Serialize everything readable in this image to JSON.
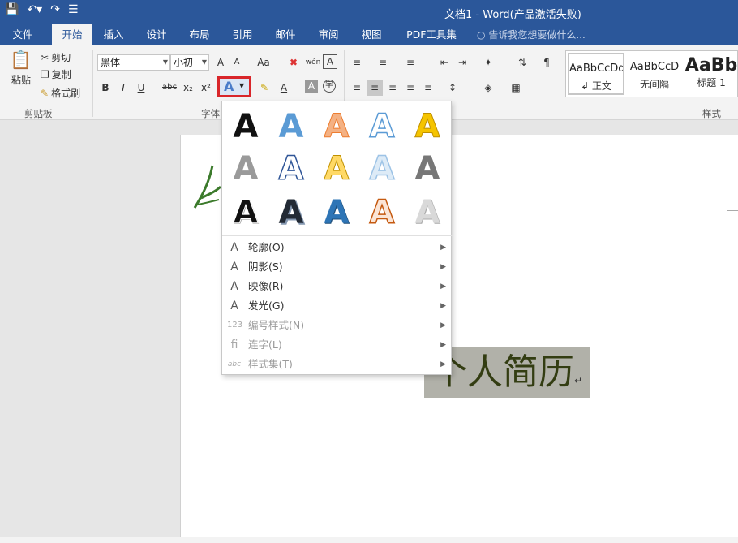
{
  "window": {
    "title": "文档1 - Word(产品激活失败)"
  },
  "qat": {
    "save_icon": "save-icon",
    "undo_icon": "undo-icon",
    "redo_icon": "redo-icon",
    "customize_icon": "customize-icon"
  },
  "tabs": [
    {
      "label": "文件"
    },
    {
      "label": "开始"
    },
    {
      "label": "插入"
    },
    {
      "label": "设计"
    },
    {
      "label": "布局"
    },
    {
      "label": "引用"
    },
    {
      "label": "邮件"
    },
    {
      "label": "审阅"
    },
    {
      "label": "视图"
    },
    {
      "label": "PDF工具集"
    }
  ],
  "tellme": "告诉我您想要做什么...",
  "clipboard": {
    "paste": "粘贴",
    "cut": "剪切",
    "copy": "复制",
    "format_painter": "格式刷",
    "group_label": "剪贴板"
  },
  "font": {
    "name": "黑体",
    "size": "小初",
    "group_label": "字体",
    "buttons": [
      "A",
      "A",
      "Aa",
      "A",
      "B",
      "I",
      "U",
      "abc",
      "x₂",
      "x²",
      "A",
      "A",
      "A",
      "字"
    ]
  },
  "styles": [
    {
      "sample": "AaBbCcDd",
      "name": "↲ 正文"
    },
    {
      "sample": "AaBbCcD",
      "name": "无间隔"
    },
    {
      "sample": "AaBb",
      "name": "标题 1"
    }
  ],
  "styles_group_label": "样式",
  "text_effects_menu": {
    "items": [
      {
        "label": "轮廓(O)",
        "icon": "outline-a-icon",
        "disabled": false
      },
      {
        "label": "阴影(S)",
        "icon": "shadow-a-icon",
        "disabled": false
      },
      {
        "label": "映像(R)",
        "icon": "reflection-a-icon",
        "disabled": false
      },
      {
        "label": "发光(G)",
        "icon": "glow-a-icon",
        "disabled": false
      },
      {
        "label": "编号样式(N)",
        "icon": "number-style-icon",
        "disabled": true
      },
      {
        "label": "连字(L)",
        "icon": "ligature-icon",
        "disabled": true
      },
      {
        "label": "样式集(T)",
        "icon": "stylistic-set-icon",
        "disabled": true
      }
    ],
    "effect_glyph": "A"
  },
  "document": {
    "heading": "个人简历"
  },
  "colors": {
    "brand": "#2b579a",
    "highlight_border": "#d9262a"
  }
}
